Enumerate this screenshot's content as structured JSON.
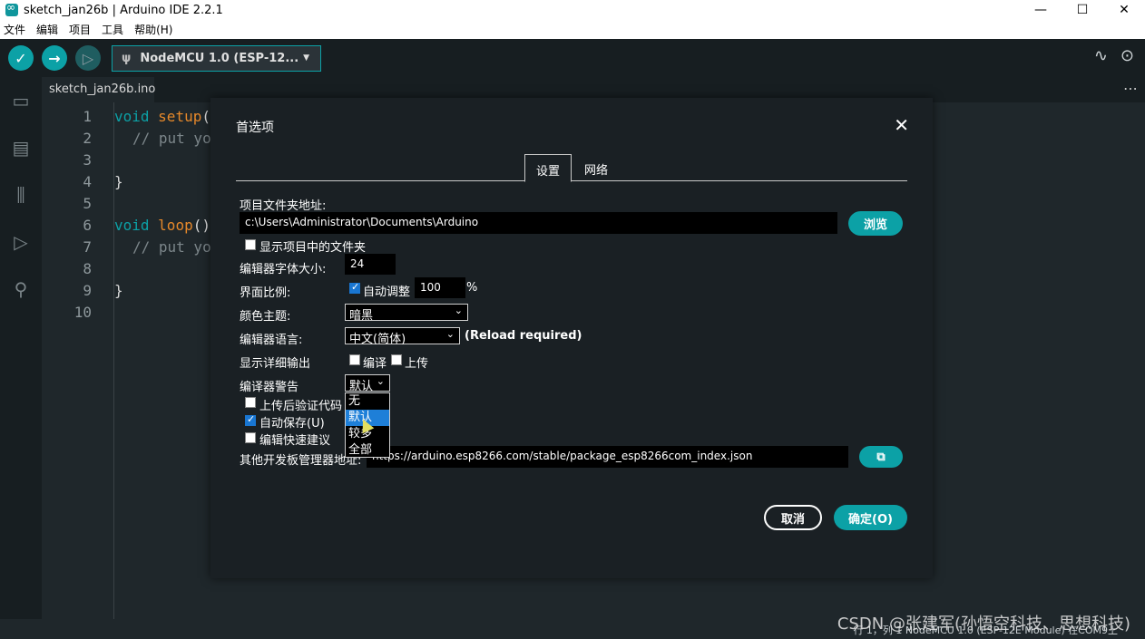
{
  "window": {
    "title": "sketch_jan26b | Arduino IDE 2.2.1",
    "controls": [
      "—",
      "☐",
      "✕"
    ]
  },
  "menu": [
    "文件",
    "编辑",
    "项目",
    "工具",
    "帮助(H)"
  ],
  "toolbar": {
    "verify_icon": "check-icon",
    "upload_icon": "arrow-right-icon",
    "debug_icon": "debug-icon",
    "board": "NodeMCU 1.0 (ESP-12..."
  },
  "editor": {
    "file_tab": "sketch_jan26b.ino",
    "line_numbers": [
      "1",
      "2",
      "3",
      "4",
      "5",
      "6",
      "7",
      "8",
      "9",
      "10"
    ],
    "lines": [
      {
        "kw": "void",
        "fn": "setup",
        "rest": "("
      },
      {
        "cm": "// put yo"
      },
      {},
      {
        "pl": "}"
      },
      {},
      {
        "kw": "void",
        "fn": "loop",
        "rest": "()"
      },
      {
        "cm": "// put yo"
      },
      {},
      {
        "pl": "}"
      },
      {}
    ]
  },
  "dialog": {
    "title": "首选项",
    "close": "✕",
    "tabs": {
      "settings": "设置",
      "network": "网络"
    },
    "sketchbook_label": "项目文件夹地址:",
    "sketchbook_path": "c:\\Users\\Administrator\\Documents\\Arduino",
    "browse": "浏览",
    "show_files_label": "显示项目中的文件夹",
    "font_size_label": "编辑器字体大小:",
    "font_size": "24",
    "scale_label": "界面比例:",
    "auto_adjust_label": "自动调整",
    "scale_value": "100",
    "scale_unit": "%",
    "theme_label": "颜色主题:",
    "theme_value": "暗黑",
    "language_label": "编辑器语言:",
    "language_value": "中文(简体)",
    "reload_note": "(Reload required)",
    "verbose_label": "显示详细输出",
    "verbose_compile": "编译",
    "verbose_upload": "上传",
    "warnings_label": "编译器警告",
    "warnings_value": "默认",
    "warnings_options": [
      "无",
      "默认",
      "较多",
      "全部"
    ],
    "verify_label": "上传后验证代码",
    "autosave_label": "自动保存(U)",
    "quick_suggest_label": "编辑快速建议",
    "board_urls_label": "其他开发板管理器地址:",
    "board_urls": "https://arduino.esp8266.com/stable/package_esp8266com_index.json",
    "cancel": "取消",
    "ok": "确定(O)"
  },
  "status": "行 1，列 1   NodeMCU 1.0 (ESP-12E Module) 在COM9上",
  "watermark": "CSDN @张建军(孙悟空科技、思想科技)"
}
